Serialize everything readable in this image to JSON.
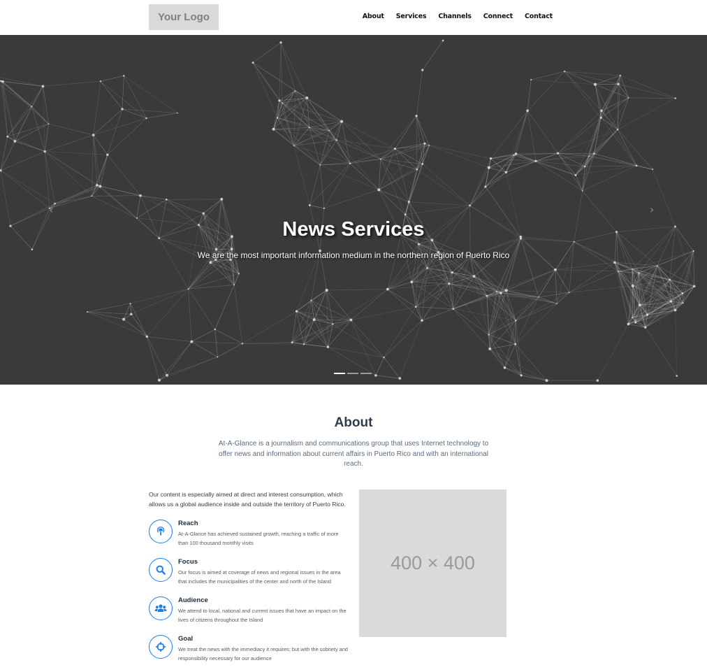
{
  "header": {
    "logo_text": "Your Logo",
    "nav": [
      "About",
      "Services",
      "Channels",
      "Connect",
      "Contact"
    ]
  },
  "hero": {
    "title": "News Services",
    "subtitle": "We are the most important information medium in the northern region of Puerto Rico",
    "prev_arrow": "‹",
    "next_arrow": "›",
    "slides_count": 3,
    "active_slide": 1
  },
  "about": {
    "title": "About",
    "lead": "At-A-Glance is a journalism and communications group that uses Internet technology to offer news and information about current affairs in Puerto Rico and with an international reach.",
    "intro": "Our content is especially aimed at direct and interest consumption, which allows us a global audience inside and outside the territory of Puerto Rico.",
    "features": [
      {
        "icon": "podcast-icon",
        "title": "Reach",
        "desc": "At-A-Glance has achieved sustained growth, reaching a traffic of more than 100 thousand monthly visits"
      },
      {
        "icon": "search-icon",
        "title": "Focus",
        "desc": "Our focus is aimed at coverage of news and regional issues in the area that includes the municipalities of the center and north of the Island"
      },
      {
        "icon": "users-icon",
        "title": "Audience",
        "desc": "We attend to local, national and current issues that have an impact on the lives of citizens throughout the Island"
      },
      {
        "icon": "crosshairs-icon",
        "title": "Goal",
        "desc": "We treat the news with the immediacy it requires; but with the sobriety and responsibility necessary for our audience"
      }
    ],
    "image_placeholder": "400 × 400"
  },
  "colors": {
    "accent": "#1a7cf0",
    "hero_bg": "#3a3a3a",
    "heading": "#2e3b4a"
  }
}
